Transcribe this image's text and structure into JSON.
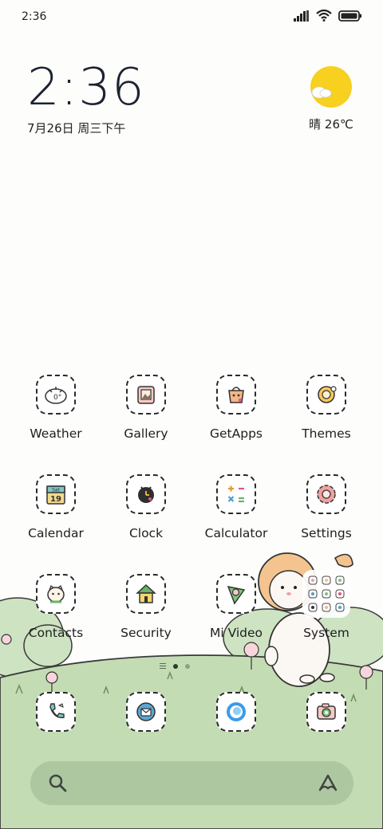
{
  "status_bar": {
    "time": "2:36"
  },
  "clock_widget": {
    "time": "2:36",
    "date": "7月26日 周三下午"
  },
  "weather_widget": {
    "text": "晴 26℃",
    "icon": "sunny-icon"
  },
  "apps": [
    {
      "id": "weather",
      "label": "Weather",
      "icon": "weather-icon"
    },
    {
      "id": "gallery",
      "label": "Gallery",
      "icon": "gallery-icon"
    },
    {
      "id": "getapps",
      "label": "GetApps",
      "icon": "getapps-icon"
    },
    {
      "id": "themes",
      "label": "Themes",
      "icon": "themes-icon"
    },
    {
      "id": "calendar",
      "label": "Calendar",
      "icon": "calendar-icon",
      "day_name": "Sat",
      "day_number": "19"
    },
    {
      "id": "clock",
      "label": "Clock",
      "icon": "clock-icon"
    },
    {
      "id": "calculator",
      "label": "Calculator",
      "icon": "calculator-icon"
    },
    {
      "id": "settings",
      "label": "Settings",
      "icon": "settings-icon"
    },
    {
      "id": "contacts",
      "label": "Contacts",
      "icon": "contacts-icon"
    },
    {
      "id": "security",
      "label": "Security",
      "icon": "security-icon"
    },
    {
      "id": "mivideo",
      "label": "Mi Video",
      "icon": "mi-video-icon"
    },
    {
      "id": "system",
      "label": "System",
      "icon": "system-folder-icon"
    }
  ],
  "dock": [
    {
      "id": "phone",
      "icon": "phone-icon"
    },
    {
      "id": "messages",
      "icon": "messages-icon"
    },
    {
      "id": "browser",
      "icon": "browser-icon"
    },
    {
      "id": "camera",
      "icon": "camera-icon"
    }
  ],
  "page_indicator": {
    "pages": 2,
    "active_page": 1
  },
  "search_bar": {
    "icon": "search-icon",
    "assistant_icon": "assistant-icon"
  },
  "colors": {
    "hill_green": "#c4dcb4",
    "sun_yellow": "#f7d020",
    "cat_orange": "#f3c48f"
  }
}
